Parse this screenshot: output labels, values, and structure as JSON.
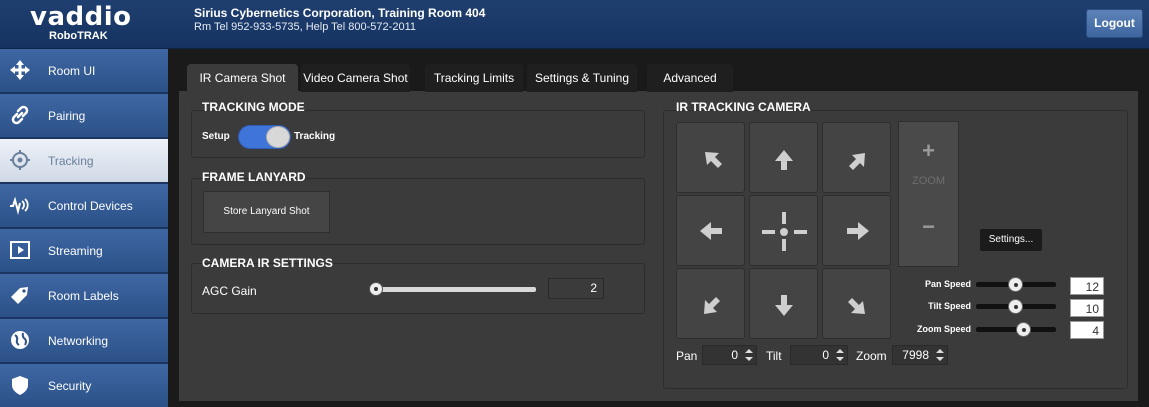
{
  "header": {
    "logo": "vaddio",
    "product": "RoboTRAK",
    "company": "Sirius Cybernetics Corporation, Training Room 404",
    "phones": "Rm Tel 952-933-5735, Help Tel 800-572-2011",
    "logout_label": "Logout"
  },
  "sidebar": {
    "items": [
      {
        "label": "Room UI",
        "icon": "move-arrows-icon"
      },
      {
        "label": "Pairing",
        "icon": "link-icon"
      },
      {
        "label": "Tracking",
        "icon": "target-icon",
        "active": true
      },
      {
        "label": "Control Devices",
        "icon": "signal-icon"
      },
      {
        "label": "Streaming",
        "icon": "play-icon"
      },
      {
        "label": "Room Labels",
        "icon": "tag-icon"
      },
      {
        "label": "Networking",
        "icon": "globe-icon"
      },
      {
        "label": "Security",
        "icon": "shield-icon"
      }
    ]
  },
  "tabs": [
    {
      "label": "IR Camera Shot",
      "active": true
    },
    {
      "label": "Video Camera Shot"
    },
    {
      "label": "Tracking Limits"
    },
    {
      "label": "Settings & Tuning"
    },
    {
      "label": "Advanced"
    }
  ],
  "tracking_mode": {
    "title": "TRACKING MODE",
    "left_label": "Setup",
    "right_label": "Tracking",
    "state": "Tracking"
  },
  "frame_lanyard": {
    "title": "FRAME LANYARD",
    "button_label": "Store Lanyard Shot"
  },
  "camera_ir": {
    "title": "CAMERA IR SETTINGS",
    "agc_label": "AGC Gain",
    "agc_value": "2",
    "agc_fraction": 0
  },
  "ir_camera": {
    "title": "IR TRACKING CAMERA",
    "zoom_label": "ZOOM",
    "zoom_in": "+",
    "zoom_out": "−",
    "settings_label": "Settings...",
    "speeds": [
      {
        "label": "Pan Speed",
        "value": "12",
        "fraction": 0.5
      },
      {
        "label": "Tilt Speed",
        "value": "10",
        "fraction": 0.5
      },
      {
        "label": "Zoom Speed",
        "value": "4",
        "fraction": 0.6
      }
    ],
    "pan_label": "Pan",
    "pan_value": "0",
    "tilt_label": "Tilt",
    "tilt_value": "0",
    "zoom_pos_label": "Zoom",
    "zoom_value": "7998"
  },
  "colors": {
    "header": "#1f3f70",
    "sidebar": "#3f67a3",
    "toggle_on": "#3f74d8",
    "panel": "#3b3b3b"
  }
}
